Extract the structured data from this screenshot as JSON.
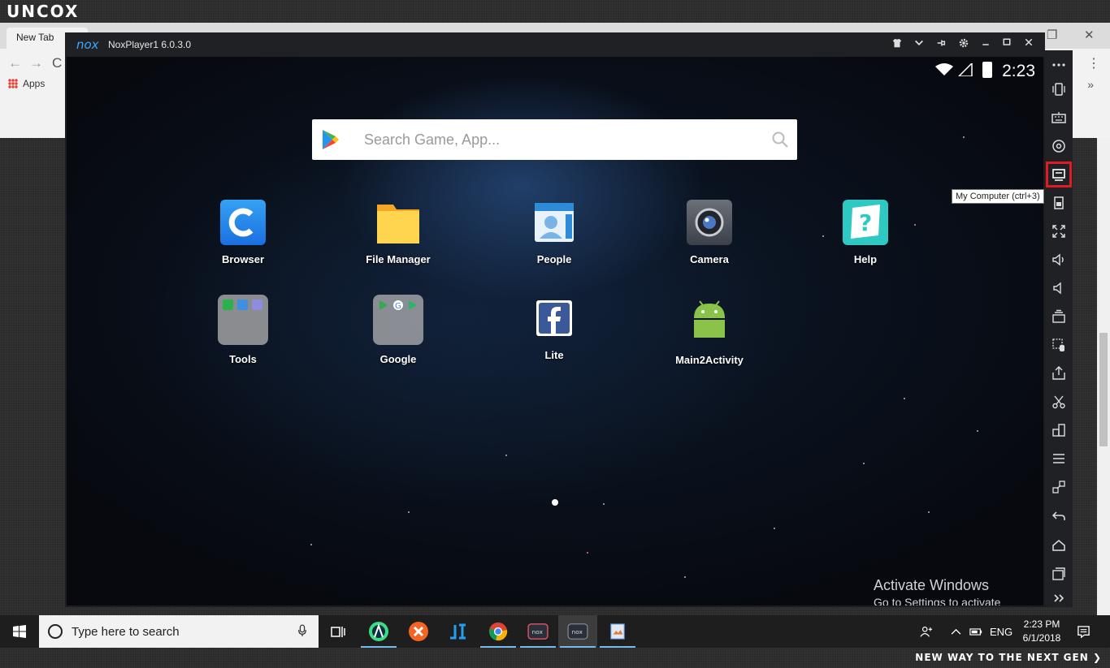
{
  "brand": {
    "logo": "UNCOX",
    "tagline": "NEW WAY TO THE NEXT GEN ❯"
  },
  "browser": {
    "tab_label": "New Tab",
    "bookmarks_apps_label": "Apps"
  },
  "nox": {
    "logo": "nox",
    "title": "NoxPlayer1 6.0.3.0",
    "status_time": "2:23",
    "search_placeholder": "Search Game, App...",
    "apps": [
      {
        "label": "Browser",
        "icon": "browser-icon"
      },
      {
        "label": "File Manager",
        "icon": "file-manager-icon"
      },
      {
        "label": "People",
        "icon": "people-icon"
      },
      {
        "label": "Camera",
        "icon": "camera-icon"
      },
      {
        "label": "Help",
        "icon": "help-icon"
      },
      {
        "label": "Tools",
        "icon": "tools-folder-icon"
      },
      {
        "label": "Google",
        "icon": "google-folder-icon"
      },
      {
        "label": "Lite",
        "icon": "facebook-lite-icon"
      },
      {
        "label": "Main2Activity",
        "icon": "android-icon"
      }
    ],
    "tooltip": "My Computer (ctrl+3)",
    "watermark": {
      "line1": "Activate Windows",
      "line2": "Go to Settings to activate Windows."
    }
  },
  "taskbar": {
    "search_placeholder": "Type here to search",
    "language": "ENG",
    "time": "2:23 PM",
    "date": "6/1/2018"
  },
  "colors": {
    "highlight": "#e01b24",
    "nox_blue": "#3aa8ff",
    "taskbar": "#1e1e1e"
  }
}
